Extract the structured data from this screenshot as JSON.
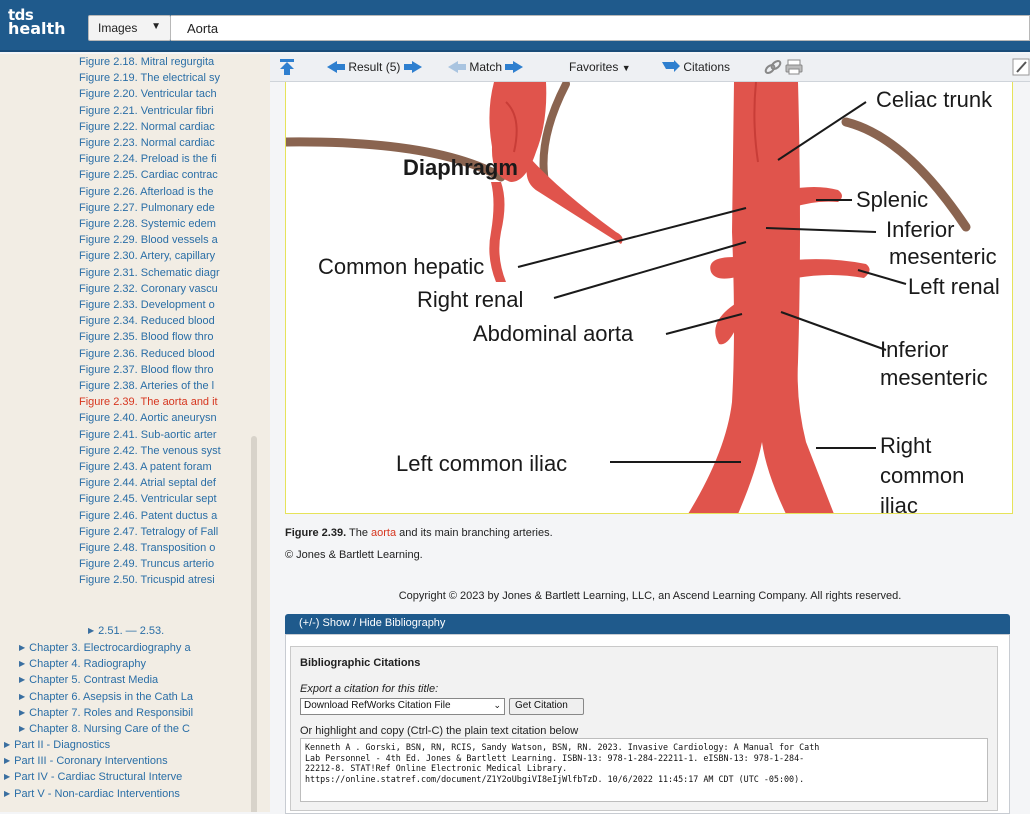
{
  "header": {
    "logo_line1": "tds",
    "logo_line2": "health",
    "scope_label": "Images",
    "search_value": "Aorta"
  },
  "sidebar": {
    "figures": [
      {
        "label": "Figure 2.18. Mitral regurgita",
        "active": false
      },
      {
        "label": "Figure 2.19. The electrical sy",
        "active": false
      },
      {
        "label": "Figure 2.20. Ventricular tach",
        "active": false
      },
      {
        "label": "Figure 2.21. Ventricular fibri",
        "active": false
      },
      {
        "label": "Figure 2.22. Normal cardiac",
        "active": false
      },
      {
        "label": "Figure 2.23. Normal cardiac",
        "active": false
      },
      {
        "label": "Figure 2.24. Preload is the fi",
        "active": false
      },
      {
        "label": "Figure 2.25. Cardiac contrac",
        "active": false
      },
      {
        "label": "Figure 2.26. Afterload is the",
        "active": false
      },
      {
        "label": "Figure 2.27. Pulmonary ede",
        "active": false
      },
      {
        "label": "Figure 2.28. Systemic edem",
        "active": false
      },
      {
        "label": "Figure 2.29. Blood vessels a",
        "active": false
      },
      {
        "label": "Figure 2.30. Artery, capillary",
        "active": false
      },
      {
        "label": "Figure 2.31. Schematic diagr",
        "active": false
      },
      {
        "label": "Figure 2.32. Coronary vascu",
        "active": false
      },
      {
        "label": "Figure 2.33. Development o",
        "active": false
      },
      {
        "label": "Figure 2.34. Reduced blood",
        "active": false
      },
      {
        "label": "Figure 2.35. Blood flow thro",
        "active": false
      },
      {
        "label": "Figure 2.36. Reduced blood",
        "active": false
      },
      {
        "label": "Figure 2.37. Blood flow thro",
        "active": false
      },
      {
        "label": "Figure 2.38. Arteries of the l",
        "active": false
      },
      {
        "label": "Figure 2.39. The aorta and it",
        "active": true
      },
      {
        "label": "Figure 2.40. Aortic aneurysn",
        "active": false
      },
      {
        "label": "Figure 2.41. Sub-aortic arter",
        "active": false
      },
      {
        "label": "Figure 2.42. The venous syst",
        "active": false
      },
      {
        "label": "Figure 2.43. A patent foram",
        "active": false
      },
      {
        "label": "Figure 2.44. Atrial septal def",
        "active": false
      },
      {
        "label": "Figure 2.45. Ventricular sept",
        "active": false
      },
      {
        "label": "Figure 2.46. Patent ductus a",
        "active": false
      },
      {
        "label": "Figure 2.47. Tetralogy of Fall",
        "active": false
      },
      {
        "label": "Figure 2.48. Transposition o",
        "active": false
      },
      {
        "label": "Figure 2.49. Truncus arterio",
        "active": false
      },
      {
        "label": "Figure 2.50. Tricuspid atresi",
        "active": false
      }
    ],
    "range_label": "2.51. — 2.53.",
    "chapters": [
      "Chapter 3. Electrocardiography a",
      "Chapter 4. Radiography",
      "Chapter 5. Contrast Media",
      "Chapter 6. Asepsis in the Cath La",
      "Chapter 7. Roles and Responsibil",
      "Chapter 8. Nursing Care of the C"
    ],
    "parts": [
      "Part II - Diagnostics",
      "Part III - Coronary Interventions",
      "Part IV - Cardiac Structural Interve",
      "Part V - Non-cardiac Interventions"
    ]
  },
  "toolbar": {
    "result_label": "Result (5)",
    "match_label": "Match",
    "favorites_label": "Favorites",
    "citations_label": "Citations"
  },
  "figure": {
    "labels": {
      "diaphragm": "Diaphragm",
      "celiac": "Celiac trunk",
      "splenic": "Splenic",
      "inferior1": "Inferior",
      "mesenteric1": "mesenteric",
      "common_hepatic": "Common hepatic",
      "left_renal": "Left renal",
      "right_renal": "Right renal",
      "abdominal": "Abdominal aorta",
      "inferior2": "Inferior",
      "mesenteric2": "mesenteric",
      "left_iliac": "Left common iliac",
      "right": "Right",
      "common": "common",
      "iliac": "iliac"
    },
    "colors": {
      "vessel": "#e0544c",
      "vessel_dark": "#c83d37",
      "diaphragm": "#8a6450",
      "frame": "#e6e35a"
    },
    "caption_num": "Figure 2.39.",
    "caption_pre": "The",
    "caption_highlight": "aorta",
    "caption_post": "and its main branching arteries.",
    "credit": "© Jones & Bartlett Learning."
  },
  "copyright": "Copyright © 2023 by Jones & Bartlett Learning, LLC, an Ascend Learning Company. All rights reserved.",
  "bibliography": {
    "toggle_label": "(+/-) Show / Hide Bibliography",
    "title": "Bibliographic Citations",
    "export_label": "Export a citation for this title:",
    "export_option": "Download RefWorks Citation File",
    "get_button": "Get Citation",
    "plain_label": "Or highlight and copy (Ctrl-C) the plain text citation below",
    "citation_text": "Kenneth A . Gorski, BSN, RN, RCIS, Sandy Watson, BSN, RN. 2023. Invasive Cardiology: A Manual for Cath\nLab Personnel - 4th Ed. Jones & Bartlett Learning. ISBN-13: 978-1-284-22211-1. eISBN-13: 978-1-284-\n22212-8. STAT!Ref Online Electronic Medical Library.\nhttps://online.statref.com/document/Z1Y2oUbgiVI8eIjWlfbTzD. 10/6/2022 11:45:17 AM CDT (UTC -05:00)."
  }
}
